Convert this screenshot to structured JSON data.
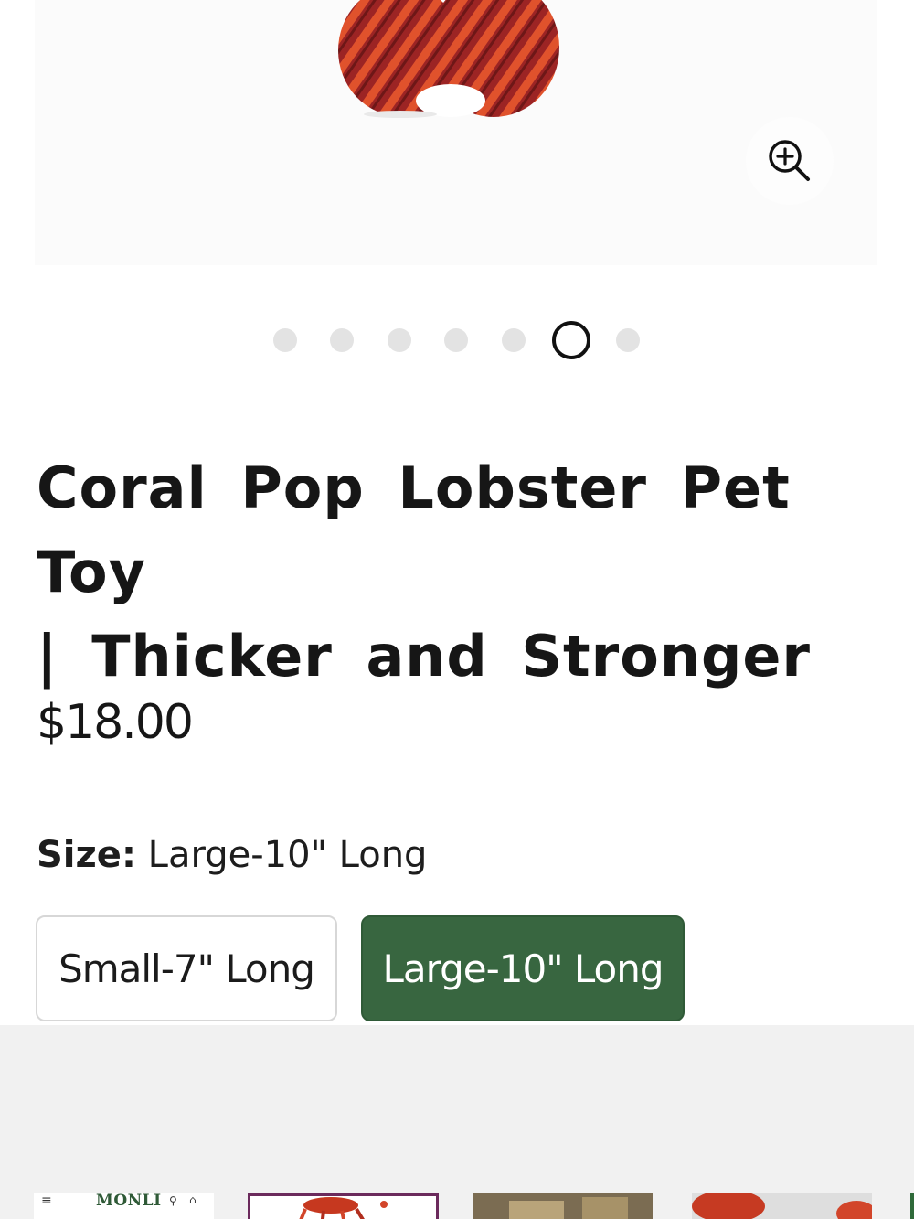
{
  "product": {
    "title_line1": "Coral Pop Lobster Pet Toy",
    "title_line2": "| Thicker and Stronger",
    "price": "$18.00",
    "image_alt": "Coral Pop Lobster Pet Toy",
    "gallery": {
      "slide_count": 7,
      "active_index": 5
    }
  },
  "size": {
    "label": "Size",
    "selected": "Large-10\" Long",
    "options": [
      "Small-7\" Long",
      "Large-10\" Long"
    ]
  },
  "thumbnails": {
    "mini_logo": "MONLI",
    "menu_glyph": "≡",
    "search_glyph": "⚲",
    "bag_glyph": "⌂"
  },
  "colors": {
    "accent_green": "#386640",
    "thumb_border": "#6b2a5c",
    "dot_inactive": "#e3e3e3",
    "toy_dark": "#9c2424",
    "toy_light": "#f0642f"
  },
  "icons": {
    "zoom": "zoom-in-icon",
    "menu": "hamburger-menu-icon",
    "search": "search-icon",
    "bag": "shopping-bag-icon"
  }
}
